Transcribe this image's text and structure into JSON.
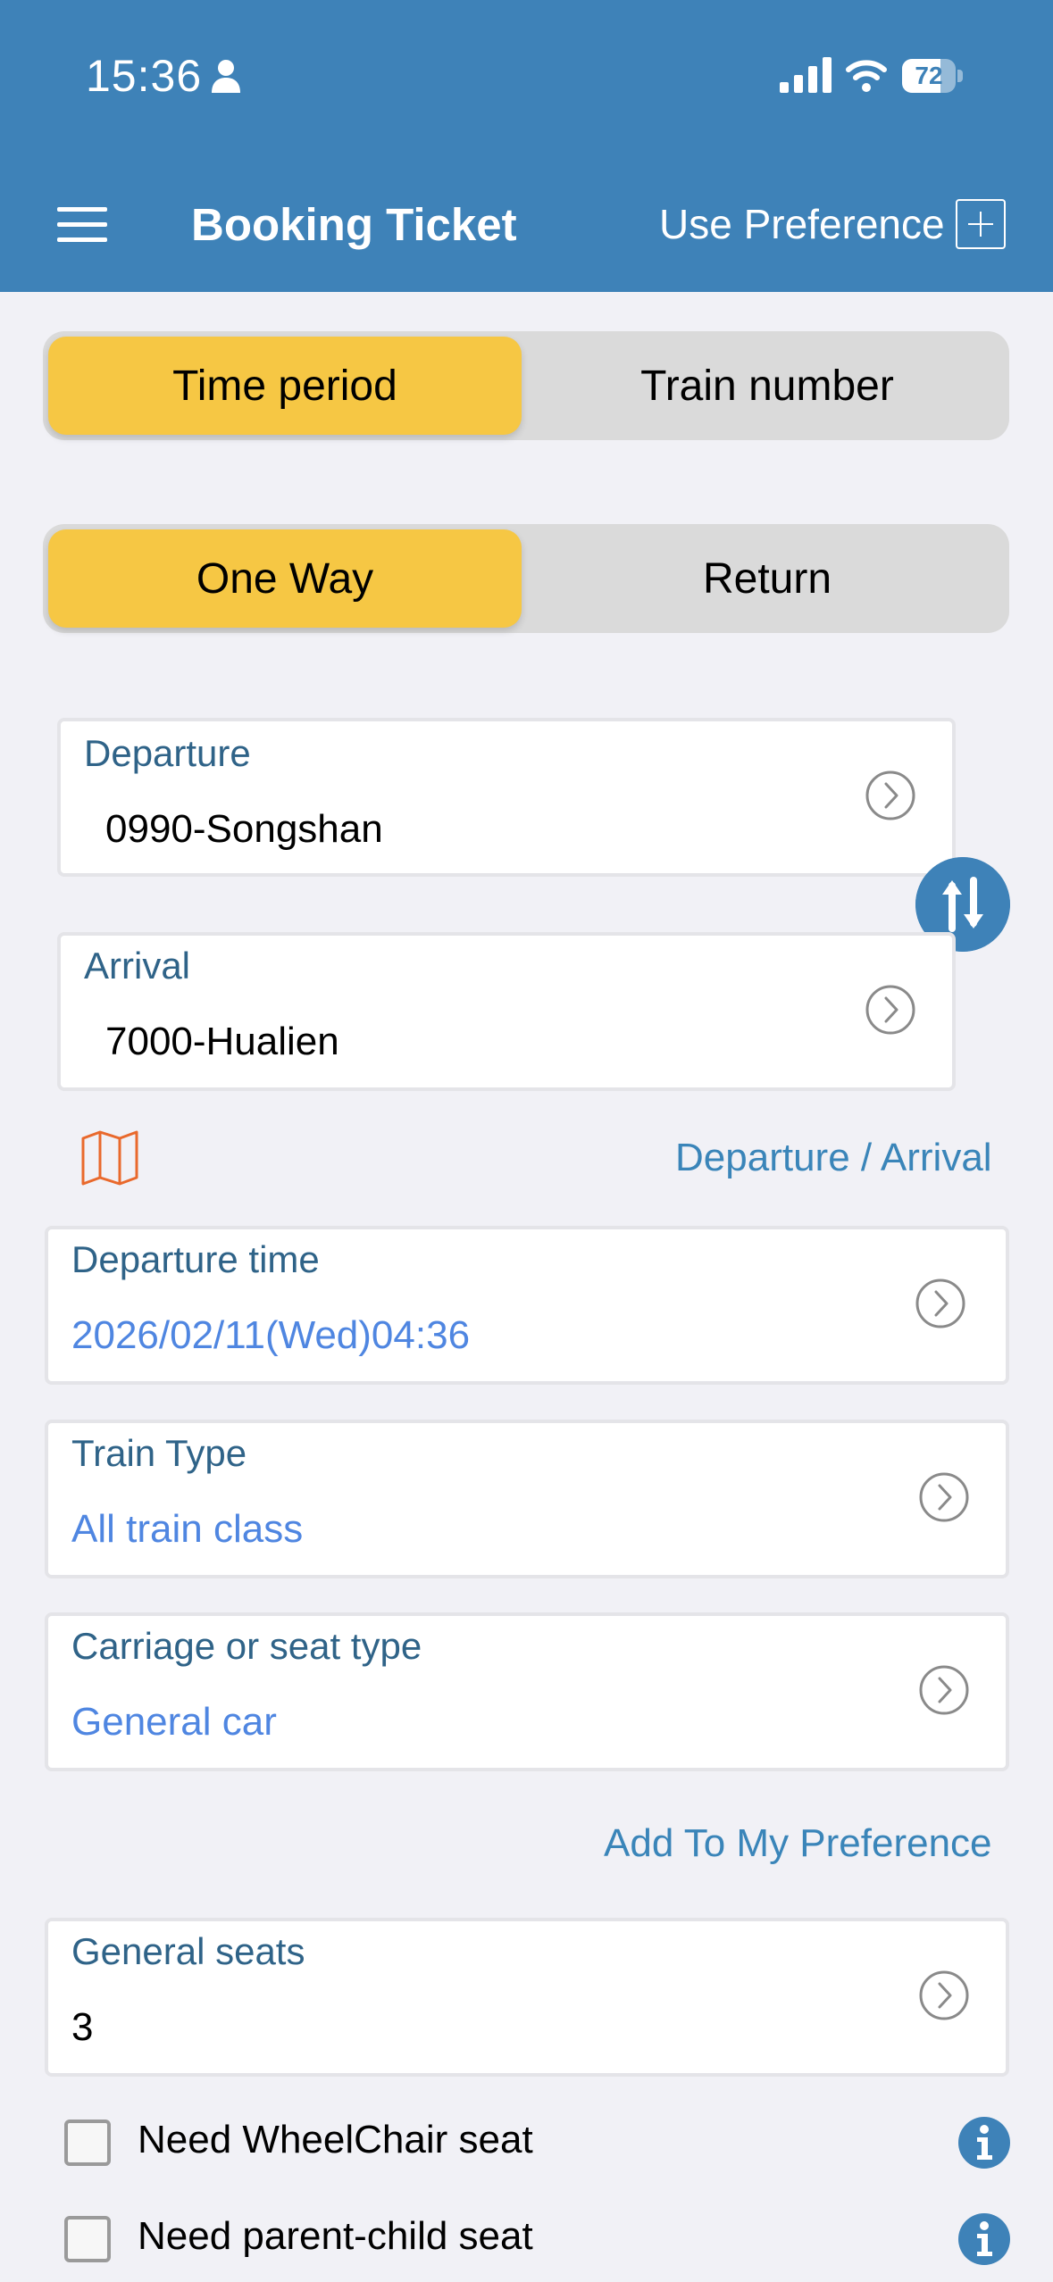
{
  "status": {
    "time": "15:36",
    "battery": "72",
    "battery_level": 0.72
  },
  "header": {
    "title": "Booking Ticket",
    "use_preference": "Use Preference"
  },
  "search_mode": {
    "options": [
      "Time period",
      "Train number"
    ],
    "selected": "Time period"
  },
  "trip_type": {
    "options": [
      "One Way",
      "Return"
    ],
    "selected": "One Way"
  },
  "departure": {
    "label": "Departure",
    "value": "0990-Songshan"
  },
  "arrival": {
    "label": "Arrival",
    "value": "7000-Hualien"
  },
  "station_link": "Departure / Arrival",
  "departure_time": {
    "label": "Departure time",
    "value": "2026/02/11(Wed)04:36"
  },
  "train_type": {
    "label": "Train Type",
    "value": "All train class"
  },
  "seat_type": {
    "label": "Carriage or seat type",
    "value": "General car"
  },
  "add_preference": "Add To My Preference",
  "general_seats": {
    "label": "General seats",
    "value": "3"
  },
  "options": [
    {
      "label": "Need WheelChair seat",
      "checked": false
    },
    {
      "label": "Need parent-child seat",
      "checked": false
    }
  ],
  "colors": {
    "header": "#3e82b8",
    "active_segment": "#f6c744",
    "link": "#3a85b9",
    "value_blue": "#4f86e1",
    "map_icon": "#e9692c"
  },
  "icons": [
    "person-icon",
    "signal-icon",
    "wifi-icon",
    "battery-icon",
    "menu-icon",
    "plus-icon",
    "chevron-right-circle-icon",
    "swap-icon",
    "map-icon",
    "info-icon"
  ]
}
